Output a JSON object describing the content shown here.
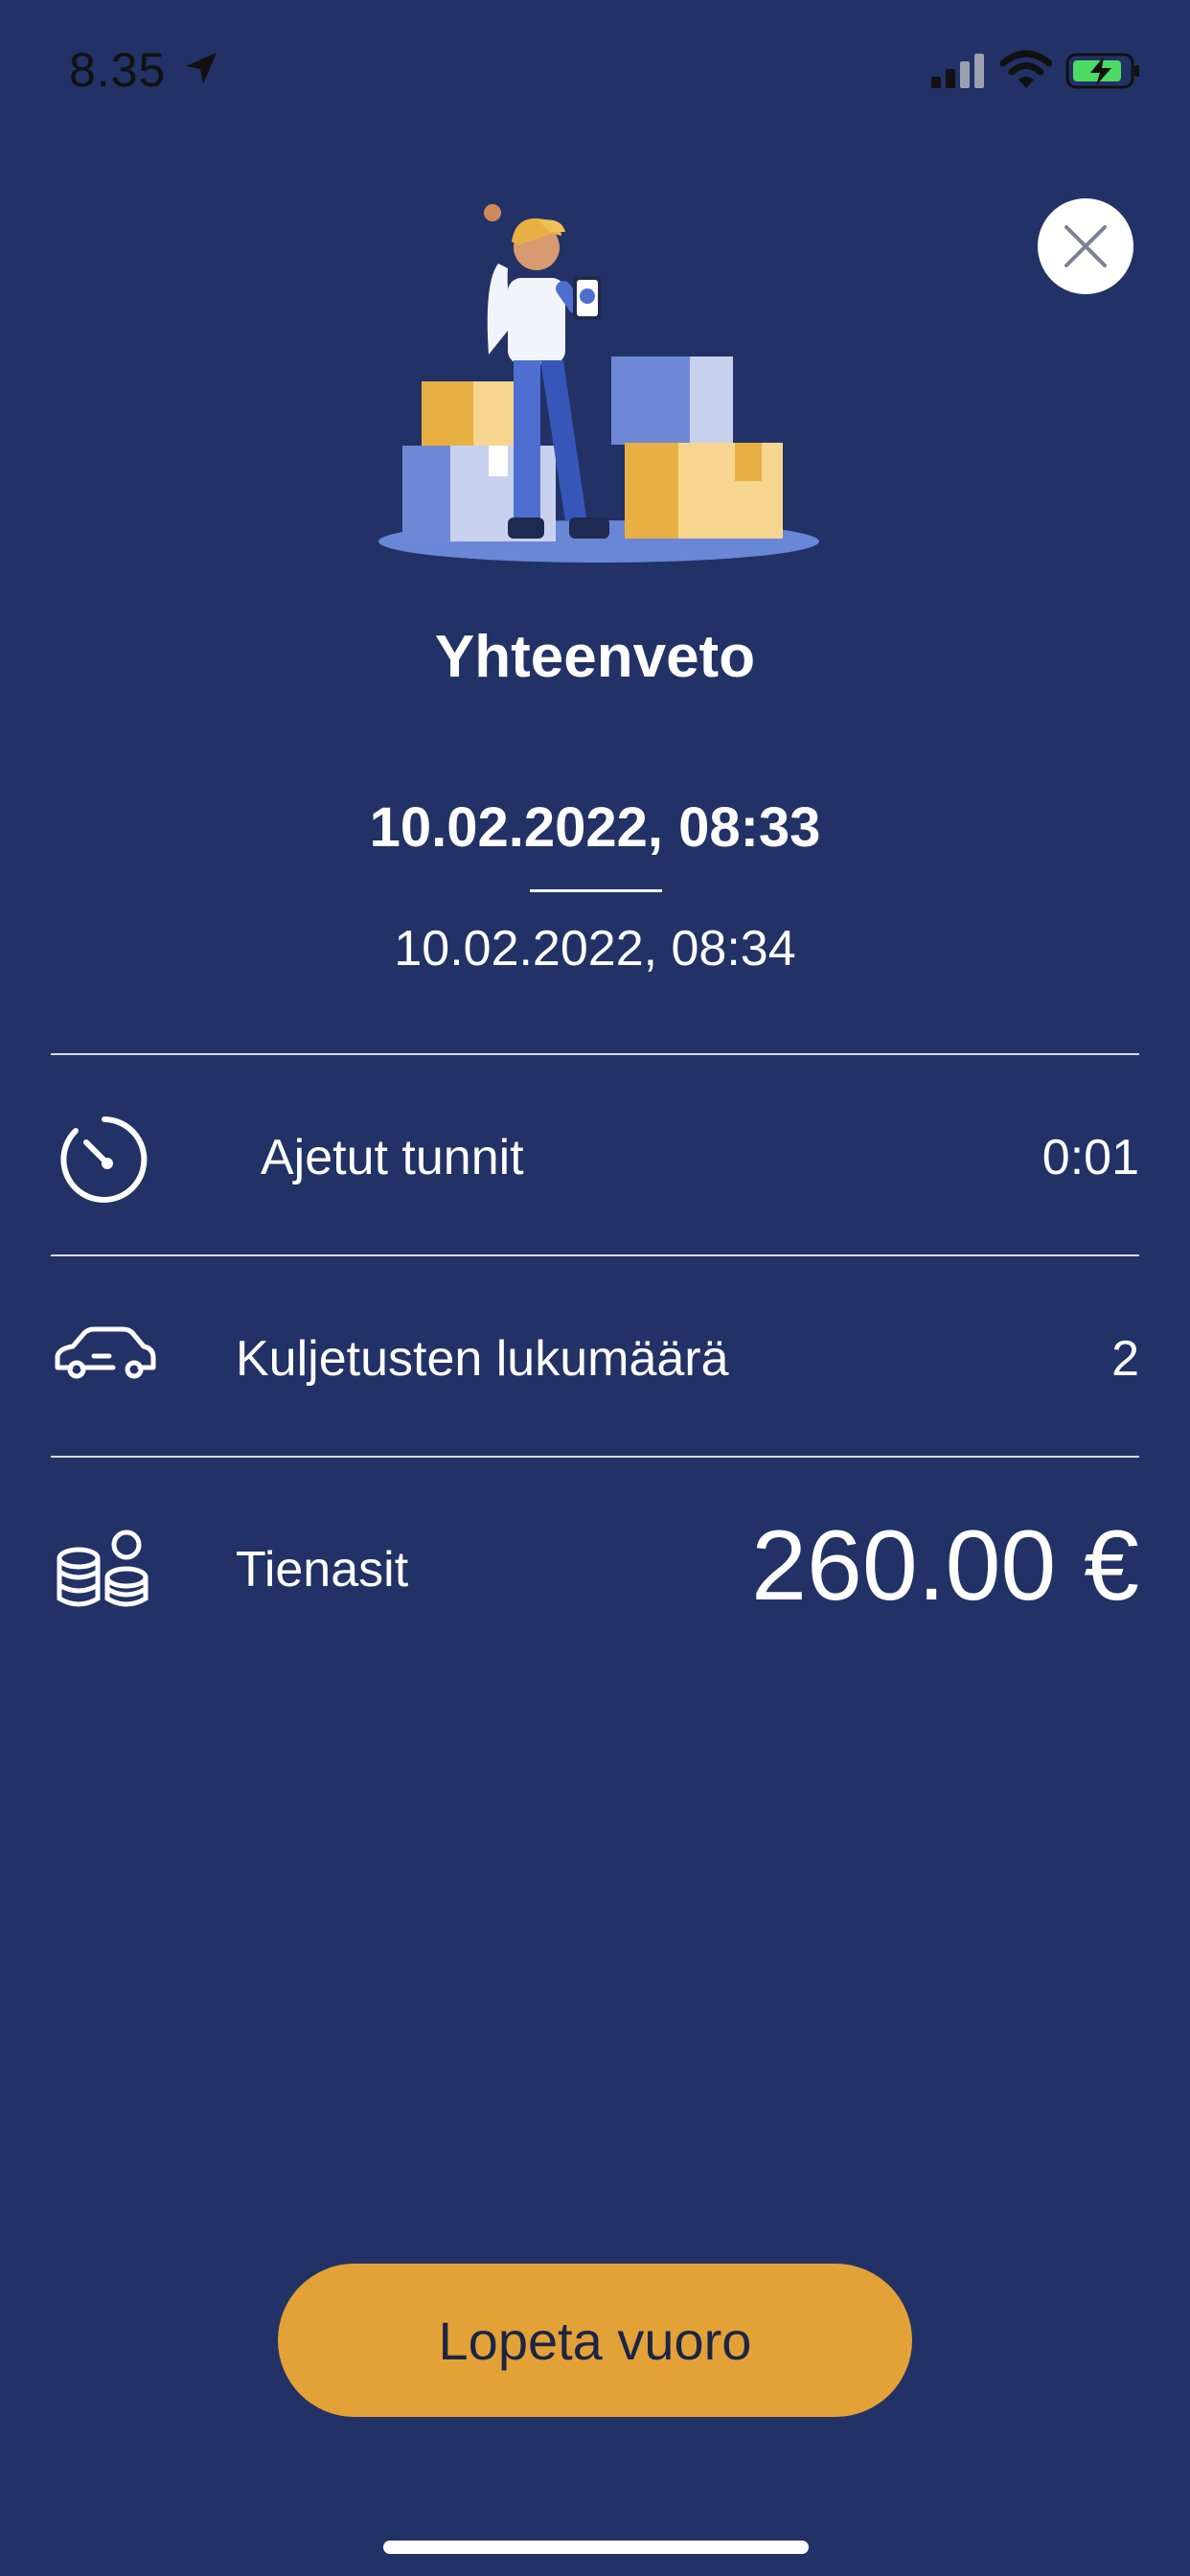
{
  "status_bar": {
    "time": "8.35",
    "icons": [
      "location-arrow-icon",
      "signal-icon",
      "wifi-icon",
      "battery-charging-icon"
    ]
  },
  "header": {
    "close_icon": "close-icon",
    "illustration": "worker-with-boxes-illustration"
  },
  "summary": {
    "title": "Yhteenveto",
    "start": "10.02.2022, 08:33",
    "end": "10.02.2022, 08:34"
  },
  "rows": [
    {
      "icon": "stopwatch-icon",
      "label": "Ajetut tunnit",
      "value": "0:01"
    },
    {
      "icon": "car-icon",
      "label": "Kuljetusten lukumäärä",
      "value": "2"
    },
    {
      "icon": "coins-icon",
      "label": "Tienasit",
      "value": "260.00 €"
    }
  ],
  "actions": {
    "end_shift": "Lopeta vuoro"
  },
  "colors": {
    "background": "#223266",
    "accent": "#e3a238",
    "button_text": "#1d2545",
    "text": "#ffffff"
  }
}
